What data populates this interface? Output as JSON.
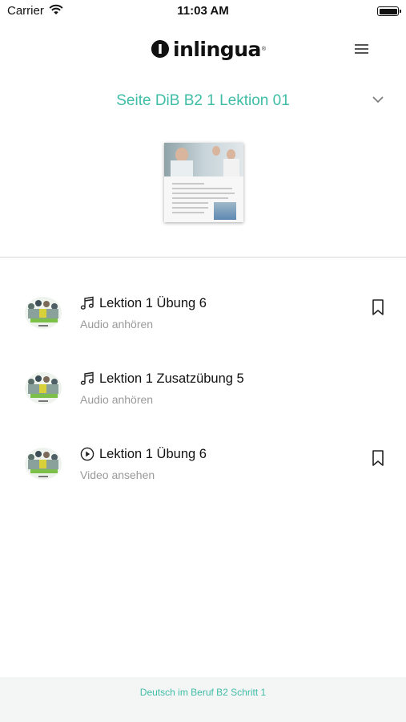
{
  "status_bar": {
    "carrier": "Carrier",
    "time": "11:03 AM"
  },
  "header": {
    "logo_text": "inlingua",
    "logo_reg": "®",
    "menu_icon": "hamburger-menu-icon"
  },
  "selector": {
    "title": "Seite DiB B2 1 Lektion 01",
    "chevron_icon": "chevron-down-icon"
  },
  "colors": {
    "accent": "#3fbda6",
    "subtitle": "#9a9a9a",
    "footer_bg": "#f4f5f5"
  },
  "items": [
    {
      "icon": "music-note-icon",
      "title": "Lektion 1 Übung 6",
      "subtitle": "Audio anhören",
      "bookmark": true
    },
    {
      "icon": "music-note-icon",
      "title": "Lektion 1 Zusatzübung 5",
      "subtitle": "Audio anhören",
      "bookmark": false
    },
    {
      "icon": "play-circle-icon",
      "title": "Lektion 1 Übung 6",
      "subtitle": "Video ansehen",
      "bookmark": true
    }
  ],
  "footer": {
    "text": "Deutsch im Beruf B2 Schritt 1"
  }
}
